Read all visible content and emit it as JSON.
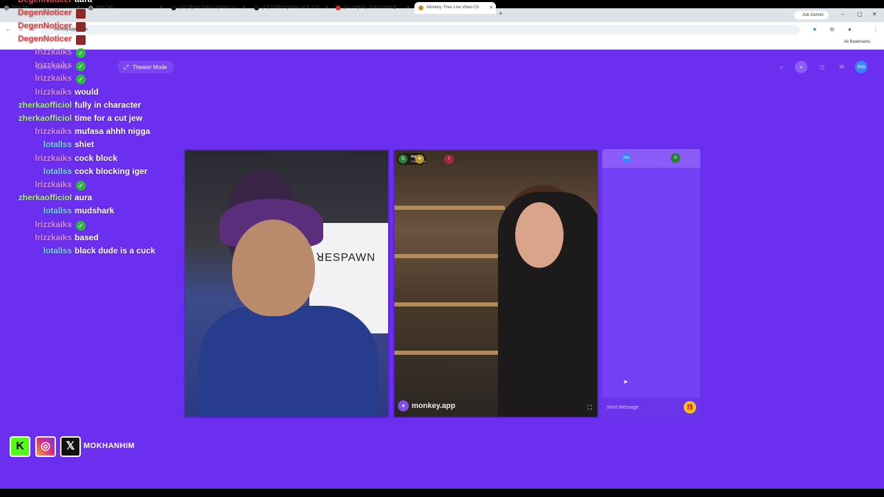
{
  "browser": {
    "tabs": [
      {
        "title": "New Tab"
      },
      {
        "title": "New Tab"
      },
      {
        "title": "(10) Myron Gaines Updates on"
      },
      {
        "title": "(17) CuffemUpdates on X: 'Cuf"
      },
      {
        "title": "(no subject) - mokszhanim@"
      },
      {
        "title": "Monkey: Free Live Video Ch"
      }
    ],
    "ask_gemini": "Ask Gemini",
    "url": "monkey.app/home",
    "all_bookmarks": "All Bookmarks"
  },
  "site": {
    "safety_center": "Safety Center",
    "theater_mode": "Theater Mode",
    "avatar_initials": "mo"
  },
  "peer": {
    "initial": "S",
    "name": "mya",
    "location": "Connecticut",
    "watermark": "monkey.app"
  },
  "chat_panel": {
    "me_initials": "mo",
    "peer_initial": "S",
    "placeholder": "Send Message"
  },
  "stream_chat": [
    {
      "user": "DegenNoticer",
      "color": "#e04a4a",
      "msg": "aura",
      "emote": ""
    },
    {
      "user": "DegenNoticer",
      "color": "#e04a4a",
      "msg": "",
      "emote": "red"
    },
    {
      "user": "DegenNoticer",
      "color": "#e04a4a",
      "msg": "",
      "emote": "red"
    },
    {
      "user": "DegenNoticer",
      "color": "#e04a4a",
      "msg": "",
      "emote": "red"
    },
    {
      "user": "lrizzkaiks",
      "color": "#d98cf0",
      "msg": "",
      "emote": "green"
    },
    {
      "user": "lrizzkaiks",
      "color": "#d98cf0",
      "msg": "",
      "emote": "green"
    },
    {
      "user": "lrizzkaiks",
      "color": "#d98cf0",
      "msg": "",
      "emote": "green"
    },
    {
      "user": "lrizzkaiks",
      "color": "#d98cf0",
      "msg": "would",
      "emote": ""
    },
    {
      "user": "zherkaofficiol",
      "color": "#a8f07a",
      "msg": "fully in character",
      "emote": ""
    },
    {
      "user": "zherkaofficiol",
      "color": "#a8f07a",
      "msg": "time for a cut jew",
      "emote": ""
    },
    {
      "user": "lrizzkaiks",
      "color": "#d98cf0",
      "msg": "mufasa ahhh nigga",
      "emote": ""
    },
    {
      "user": "lotallss",
      "color": "#7ad8f0",
      "msg": "shiet",
      "emote": ""
    },
    {
      "user": "lrizzkaiks",
      "color": "#d98cf0",
      "msg": "cock block",
      "emote": ""
    },
    {
      "user": "lotallss",
      "color": "#7ad8f0",
      "msg": "cock blocking iger",
      "emote": ""
    },
    {
      "user": "lrizzkaiks",
      "color": "#d98cf0",
      "msg": "",
      "emote": "green"
    },
    {
      "user": "zherkaofficiol",
      "color": "#a8f07a",
      "msg": "aura",
      "emote": ""
    },
    {
      "user": "lotallss",
      "color": "#7ad8f0",
      "msg": "mudshark",
      "emote": ""
    },
    {
      "user": "lrizzkaiks",
      "color": "#d98cf0",
      "msg": "",
      "emote": "green"
    },
    {
      "user": "lrizzkaiks",
      "color": "#d98cf0",
      "msg": "based",
      "emote": ""
    },
    {
      "user": "lotallss",
      "color": "#7ad8f0",
      "msg": "black dude is a cuck",
      "emote": ""
    }
  ],
  "socials": {
    "handle": "MOKHANHIM"
  }
}
